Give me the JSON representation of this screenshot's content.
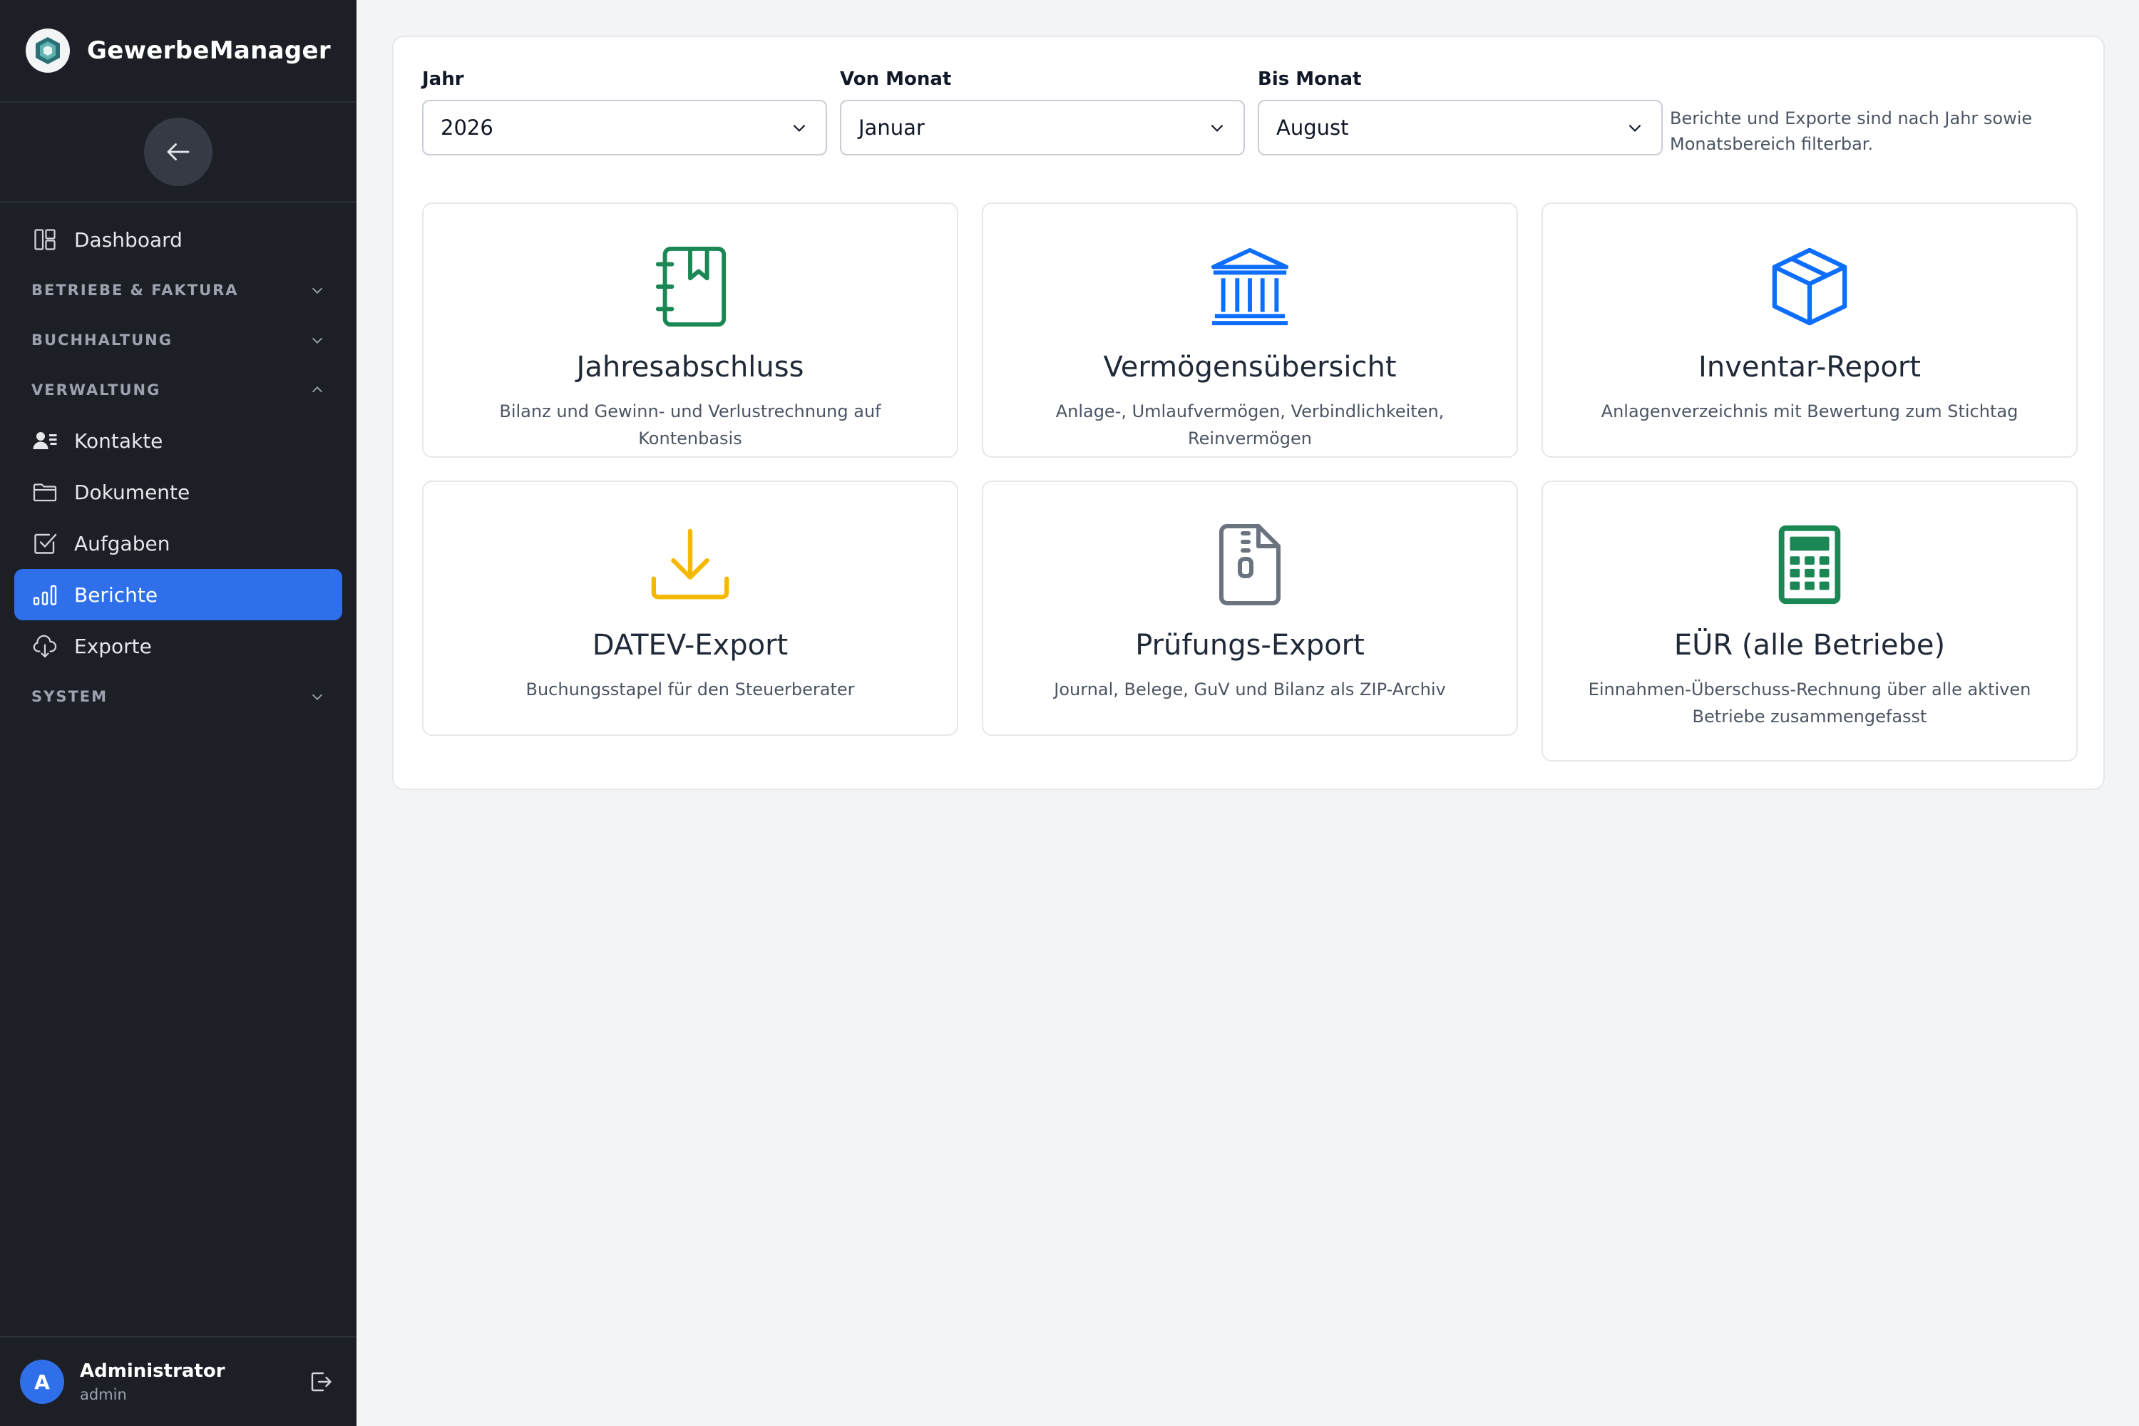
{
  "app": {
    "name": "GewerbeManager"
  },
  "sidebar": {
    "dashboard": "Dashboard",
    "sections": {
      "betriebe": "BETRIEBE & FAKTURA",
      "buchhaltung": "BUCHHALTUNG",
      "verwaltung": "VERWALTUNG",
      "system": "SYSTEM"
    },
    "items": {
      "kontakte": "Kontakte",
      "dokumente": "Dokumente",
      "aufgaben": "Aufgaben",
      "berichte": "Berichte",
      "exporte": "Exporte"
    },
    "active": "Berichte"
  },
  "user": {
    "initial": "A",
    "name": "Administrator",
    "role": "admin"
  },
  "filters": {
    "year_label": "Jahr",
    "year_value": "2026",
    "from_label": "Von Monat",
    "from_value": "Januar",
    "to_label": "Bis Monat",
    "to_value": "August",
    "hint": "Berichte und Exporte sind nach Jahr sowie Monatsbereich filterbar."
  },
  "cards": [
    {
      "title": "Jahresabschluss",
      "desc": "Bilanz und Gewinn- und Verlustrechnung auf Kontenbasis",
      "icon": "journal-bookmark-icon",
      "color": "#1a8754"
    },
    {
      "title": "Vermögensübersicht",
      "desc": "Anlage-, Umlaufvermögen, Verbindlichkeiten, Reinvermögen",
      "icon": "bank-icon",
      "color": "#0d6efd"
    },
    {
      "title": "Inventar-Report",
      "desc": "Anlagenverzeichnis mit Bewertung zum Stichtag",
      "icon": "box-icon",
      "color": "#0d6efd"
    },
    {
      "title": "DATEV-Export",
      "desc": "Buchungsstapel für den Steuerberater",
      "icon": "download-icon",
      "color": "#f5b800"
    },
    {
      "title": "Prüfungs-Export",
      "desc": "Journal, Belege, GuV und Bilanz als ZIP-Archiv",
      "icon": "zip-file-icon",
      "color": "#6b7280"
    },
    {
      "title": "EÜR (alle Betriebe)",
      "desc": "Einnahmen-Überschuss-Rechnung über alle aktiven Betriebe zusammengefasst",
      "icon": "calculator-icon",
      "color": "#1a8754"
    }
  ],
  "colors": {
    "sidebar_bg": "#1c1f26",
    "accent": "#2f6fea",
    "page_bg": "#f3f4f6"
  }
}
